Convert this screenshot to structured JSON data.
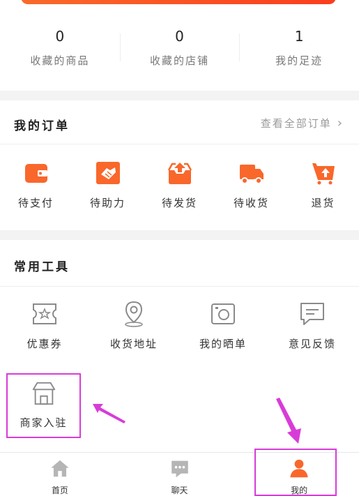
{
  "stats": [
    {
      "value": "0",
      "label": "收藏的商品"
    },
    {
      "value": "0",
      "label": "收藏的店铺"
    },
    {
      "value": "1",
      "label": "我的足迹"
    }
  ],
  "orders": {
    "title": "我的订单",
    "see_all": "查看全部订单",
    "items": [
      {
        "label": "待支付",
        "icon": "wallet-icon"
      },
      {
        "label": "待助力",
        "icon": "handshake-icon"
      },
      {
        "label": "待发货",
        "icon": "box-upload-icon"
      },
      {
        "label": "待收货",
        "icon": "truck-icon"
      },
      {
        "label": "退货",
        "icon": "return-cart-icon"
      }
    ]
  },
  "tools": {
    "title": "常用工具",
    "items": [
      {
        "label": "优惠券",
        "icon": "coupon-icon"
      },
      {
        "label": "收货地址",
        "icon": "location-pin-icon"
      },
      {
        "label": "我的晒单",
        "icon": "camera-icon"
      },
      {
        "label": "意见反馈",
        "icon": "chat-feedback-icon"
      }
    ],
    "merchant": {
      "label": "商家入驻",
      "icon": "shop-icon"
    }
  },
  "tabbar": {
    "items": [
      {
        "label": "首页",
        "icon": "home-icon"
      },
      {
        "label": "聊天",
        "icon": "chat-icon"
      },
      {
        "label": "我的",
        "icon": "person-icon",
        "active": true
      }
    ]
  },
  "colors": {
    "accent": "#f9672b",
    "annotation": "#d83cd8",
    "icon_gray": "#8a8a8a"
  }
}
